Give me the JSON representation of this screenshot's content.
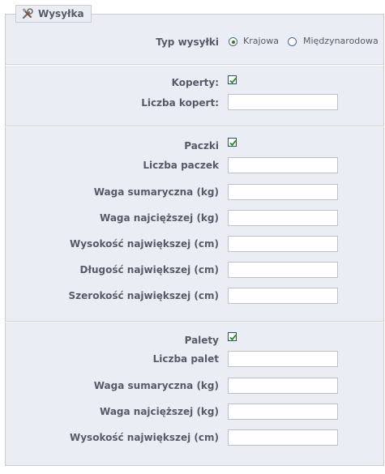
{
  "fieldset": {
    "legend": "Wysyłka",
    "legend_icon": "tools-icon"
  },
  "shipping_type": {
    "label": "Typ wysyłki",
    "options": [
      "Krajowa",
      "Międzynarodowa"
    ],
    "selected": "Krajowa"
  },
  "envelopes": {
    "label": "Koperty:",
    "checked": true,
    "count_label": "Liczba kopert:",
    "count_value": ""
  },
  "parcels": {
    "label": "Paczki",
    "checked": true,
    "fields": [
      {
        "label": "Liczba paczek",
        "value": ""
      },
      {
        "label": "Waga sumaryczna (kg)",
        "value": ""
      },
      {
        "label": "Waga najcięższej (kg)",
        "value": ""
      },
      {
        "label": "Wysokość największej (cm)",
        "value": ""
      },
      {
        "label": "Długość największej (cm)",
        "value": ""
      },
      {
        "label": "Szerokość największej (cm)",
        "value": ""
      }
    ]
  },
  "pallets": {
    "label": "Palety",
    "checked": true,
    "fields": [
      {
        "label": "Liczba palet",
        "value": ""
      },
      {
        "label": "Waga sumaryczna (kg)",
        "value": ""
      },
      {
        "label": "Waga najcięższej (kg)",
        "value": ""
      },
      {
        "label": "Wysokość największej (cm)",
        "value": ""
      }
    ]
  }
}
